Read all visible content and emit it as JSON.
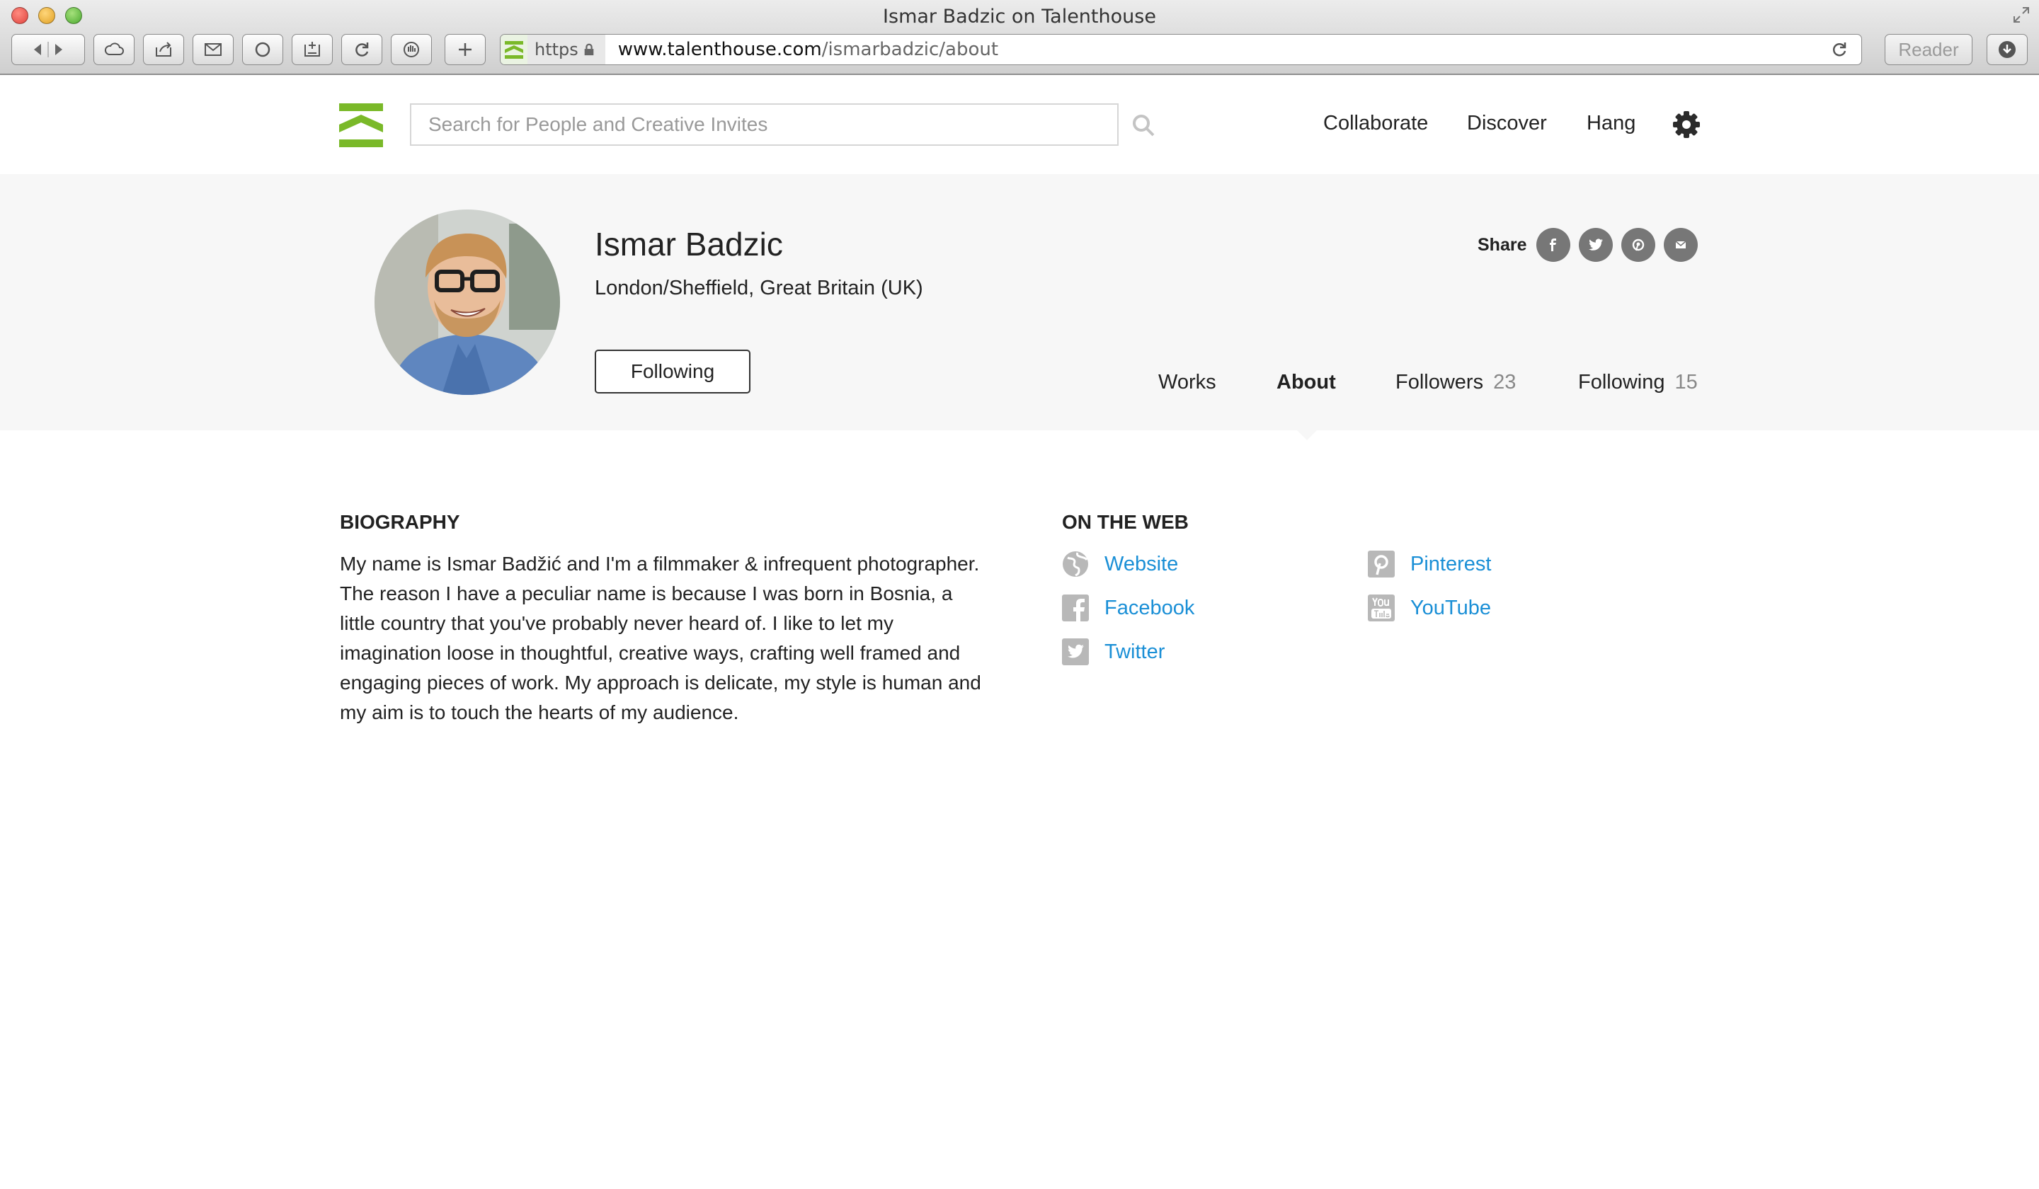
{
  "browser": {
    "window_title": "Ismar Badzic on Talenthouse",
    "url_scheme": "https",
    "url_domain": "www.talenthouse.com",
    "url_path": "/ismarbadzic/about",
    "reader_label": "Reader"
  },
  "header": {
    "search_placeholder": "Search for People and Creative Invites",
    "nav": [
      "Collaborate",
      "Discover",
      "Hang"
    ],
    "brand_color": "#7ab929"
  },
  "profile": {
    "name": "Ismar Badzic",
    "location": "London/Sheffield, Great Britain (UK)",
    "follow_button": "Following",
    "share_label": "Share",
    "share_icons": [
      "facebook-icon",
      "twitter-icon",
      "pinterest-icon",
      "email-icon"
    ],
    "tabs": [
      {
        "label": "Works",
        "count": ""
      },
      {
        "label": "About",
        "count": ""
      },
      {
        "label": "Followers",
        "count": "23"
      },
      {
        "label": "Following",
        "count": "15"
      }
    ],
    "active_tab": "About"
  },
  "biography": {
    "title": "BIOGRAPHY",
    "text": "My name is Ismar Badžić and I'm a filmmaker & infrequent photographer. The reason I have a peculiar name is because I was born in Bosnia, a little country that you've probably never heard of. I like to let my imagination loose in thoughtful, creative ways, crafting well framed and engaging pieces of work. My approach is delicate, my style is human and my aim is to touch the hearts of my audience."
  },
  "on_the_web": {
    "title": "ON THE WEB",
    "links": [
      {
        "label": "Website",
        "icon": "globe-icon"
      },
      {
        "label": "Facebook",
        "icon": "facebook-icon"
      },
      {
        "label": "Twitter",
        "icon": "twitter-icon"
      },
      {
        "label": "Pinterest",
        "icon": "pinterest-icon"
      },
      {
        "label": "YouTube",
        "icon": "youtube-icon"
      }
    ],
    "link_color": "#1a8fd6"
  }
}
